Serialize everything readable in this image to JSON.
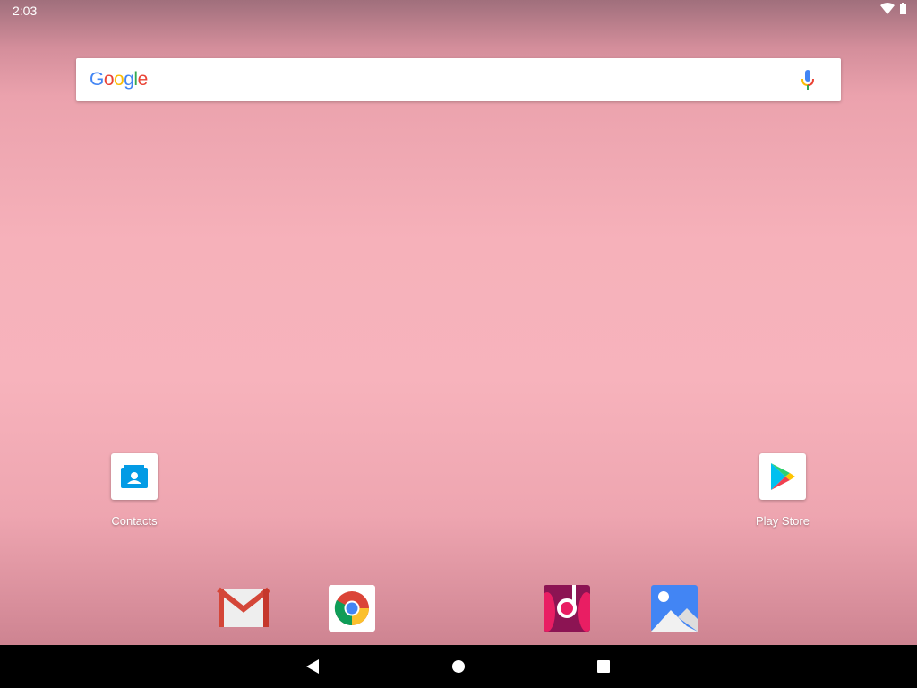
{
  "status_bar": {
    "time": "2:03",
    "icons": [
      "wifi-icon",
      "battery-icon"
    ]
  },
  "search_bar": {
    "logo": "Google",
    "mic_icon": "microphone-icon"
  },
  "desktop_apps": [
    {
      "label": "Contacts",
      "icon": "contacts-icon"
    },
    {
      "label": "Play Store",
      "icon": "play-store-icon"
    }
  ],
  "dock": [
    {
      "icon": "gmail-icon"
    },
    {
      "icon": "chrome-icon"
    },
    {
      "icon": "music-icon"
    },
    {
      "icon": "photos-icon"
    }
  ],
  "nav_bar": {
    "buttons": [
      "back-icon",
      "home-icon",
      "recents-icon"
    ]
  }
}
